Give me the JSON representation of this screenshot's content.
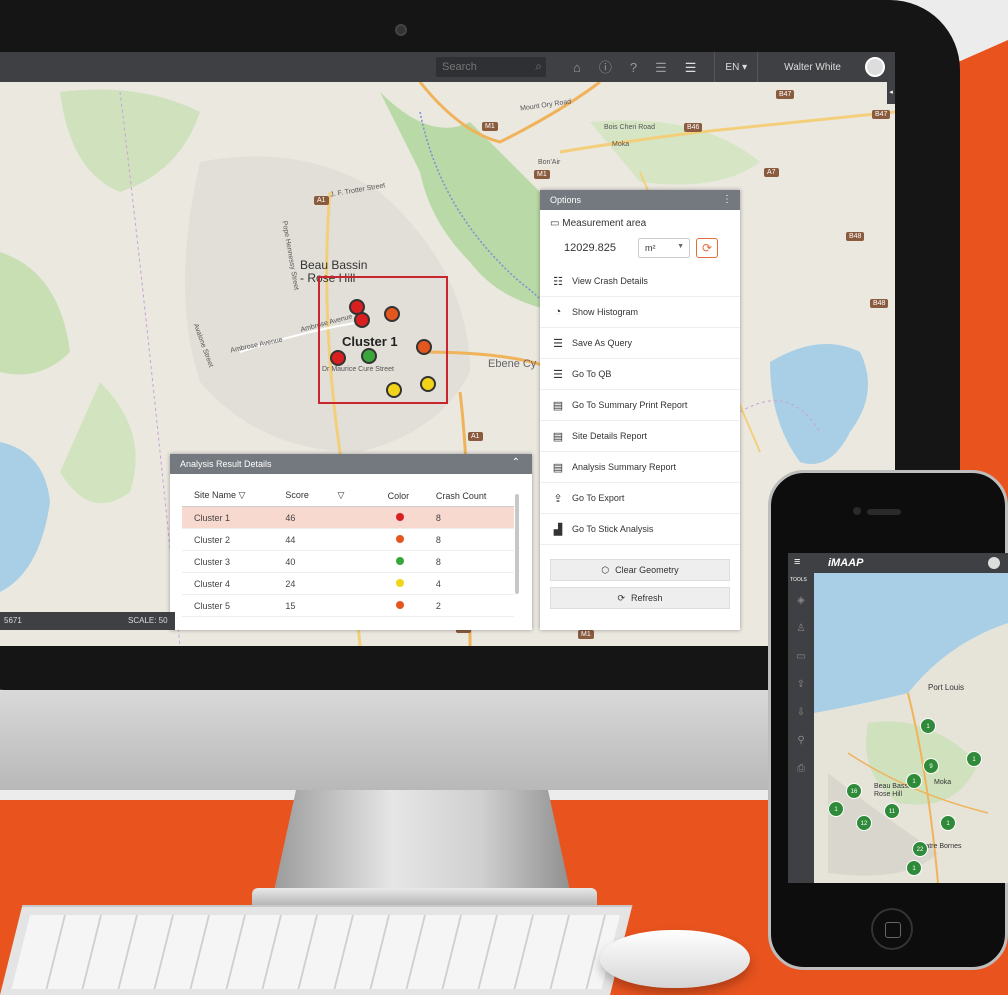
{
  "topbar": {
    "search_placeholder": "Search",
    "lang": "EN ▾",
    "user": "Walter White",
    "icons": [
      "home-icon",
      "info-icon",
      "help-icon",
      "database-icon",
      "query-db-icon"
    ]
  },
  "map": {
    "labels": {
      "moka": "Moka",
      "bon_air": "Bon'Air",
      "mount_ory": "Mount Ory Road",
      "bois_cheri": "Bois Cheri Road",
      "trotter": "J. F. Trotter Street",
      "hennessy": "Pope Hennessy Street",
      "ambrose1": "Ambrose Avenue",
      "ambrose2": "Ambrose Avenue",
      "mcure": "Dr Maurice Cure Street",
      "ebene": "Ebene Cy",
      "avalone": "Avalone Street",
      "town1": "Beau Bassin",
      "town2": "- Rose Hill",
      "cluster": "Cluster 1"
    },
    "road_badges": {
      "m1": "M1",
      "b46": "B46",
      "a7": "A7",
      "b47a": "B47",
      "b47b": "B47",
      "b48a": "B48",
      "b48b": "B48",
      "a1a": "A1",
      "a1b": "A1",
      "a1c": "A1",
      "m1b": "M1",
      "m1c": "M1"
    },
    "status_left": "5671",
    "status_scale": "SCALE: 50"
  },
  "options": {
    "title": "Options",
    "measurement_label": "Measurement area",
    "measurement_value": "12029.825",
    "unit": "m²",
    "items": [
      {
        "label": "View Crash Details",
        "icon": "list-icon"
      },
      {
        "label": "Show Histogram",
        "icon": "histogram-icon"
      },
      {
        "label": "Save As Query",
        "icon": "save-query-icon"
      },
      {
        "label": "Go To QB",
        "icon": "query-builder-icon"
      },
      {
        "label": "Go To Summary Print Report",
        "icon": "document-icon"
      },
      {
        "label": "Site Details Report",
        "icon": "document-icon"
      },
      {
        "label": "Analysis Summary Report",
        "icon": "document-icon"
      },
      {
        "label": "Go To Export",
        "icon": "export-icon"
      },
      {
        "label": "Go To Stick Analysis",
        "icon": "stick-chart-icon"
      }
    ],
    "clear_geometry": "Clear Geometry",
    "refresh": "Refresh"
  },
  "analysis": {
    "title": "Analysis Result Details",
    "columns": [
      "Site Name",
      "Score",
      "Color",
      "Crash Count"
    ],
    "rows": [
      {
        "site": "Cluster 1",
        "score": "46",
        "color": "#d91f1f",
        "count": "8"
      },
      {
        "site": "Cluster 2",
        "score": "44",
        "color": "#e3561e",
        "count": "8"
      },
      {
        "site": "Cluster 3",
        "score": "40",
        "color": "#3aa53a",
        "count": "8"
      },
      {
        "site": "Cluster 4",
        "score": "24",
        "color": "#f1d31a",
        "count": "4"
      },
      {
        "site": "Cluster 5",
        "score": "15",
        "color": "#e3561e",
        "count": "2"
      }
    ]
  },
  "phone": {
    "logo": "iMAAP",
    "tools": "TOOLS",
    "cities": {
      "port_louis": "Port Louis",
      "beau_bassin": "Beau Bassin",
      "rose_hill": "Rose Hill",
      "quatre_bornes": "Quatre Bornes",
      "moka": "Moka"
    },
    "markers": [
      "1",
      "1",
      "9",
      "1",
      "16",
      "11",
      "12",
      "1",
      "1",
      "22",
      "1"
    ]
  },
  "colors": {
    "accent": "#e8531e",
    "header": "#74797f",
    "topbar": "#3e4044"
  }
}
